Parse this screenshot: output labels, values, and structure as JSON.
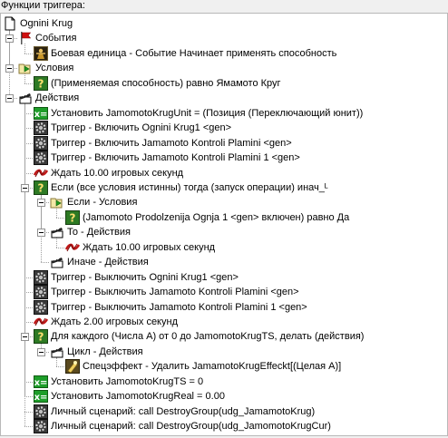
{
  "header": {
    "title": "Функции триггера:"
  },
  "tree": {
    "items": [
      {
        "label": "Ognini Krug",
        "icon": "document-icon",
        "level": 0
      },
      {
        "label": "События",
        "icon": "flag-icon",
        "level": 1,
        "expander": true
      },
      {
        "label": "Боевая единица - Событие Начинает применять способность",
        "icon": "unit-event-icon",
        "level": 2
      },
      {
        "label": "Условия",
        "icon": "condition-folder-icon",
        "level": 1,
        "expander": true
      },
      {
        "label": "(Применяемая способность) равно Ямамото Круг",
        "icon": "condition-icon",
        "level": 2
      },
      {
        "label": "Действия",
        "icon": "clapper-icon",
        "level": 1,
        "expander": true
      },
      {
        "label": "Установить JamomotoKrugUnit = (Позиция (Переключающий юнит))",
        "icon": "set-variable-icon",
        "level": 2
      },
      {
        "label": "Триггер - Включить Ognini Krug1 <gen>",
        "icon": "gear-icon",
        "level": 2
      },
      {
        "label": "Триггер - Включить Jamamoto Kontroli Plamini <gen>",
        "icon": "gear-icon",
        "level": 2
      },
      {
        "label": "Триггер - Включить Jamamoto Kontroli Plamini 1 <gen>",
        "icon": "gear-icon",
        "level": 2
      },
      {
        "label": "Ждать 10.00 игровых секунд",
        "icon": "wait-icon",
        "level": 2
      },
      {
        "label": "Если (все условия истинны) тогда (запуск операции) инач_ᴸ",
        "icon": "condition-icon",
        "level": 2,
        "expander": true
      },
      {
        "label": "Если - Условия",
        "icon": "condition-folder-icon",
        "level": 3,
        "expander": true
      },
      {
        "label": "(Jamomoto Prodolzenija Ognja 1 <gen> включен) равно Да",
        "icon": "condition-icon",
        "level": 4
      },
      {
        "label": "То - Действия",
        "icon": "clapper-icon",
        "level": 3,
        "expander": true
      },
      {
        "label": "Ждать 10.00 игровых секунд",
        "icon": "wait-icon",
        "level": 4
      },
      {
        "label": "Иначе - Действия",
        "icon": "clapper-icon",
        "level": 3
      },
      {
        "label": "Триггер - Выключить Ognini Krug1 <gen>",
        "icon": "gear-icon",
        "level": 2
      },
      {
        "label": "Триггер - Выключить Jamamoto Kontroli Plamini <gen>",
        "icon": "gear-icon",
        "level": 2
      },
      {
        "label": "Триггер - Выключить Jamamoto Kontroli Plamini 1 <gen>",
        "icon": "gear-icon",
        "level": 2
      },
      {
        "label": "Ждать 2.00 игровых секунд",
        "icon": "wait-icon",
        "level": 2
      },
      {
        "label": "Для каждого (Числа A) от 0 до JamomotoKrugTS, делать (действия)",
        "icon": "condition-icon",
        "level": 2,
        "expander": true
      },
      {
        "label": "Цикл - Действия",
        "icon": "clapper-icon",
        "level": 3,
        "expander": true
      },
      {
        "label": "Спецэффект - Удалить JamamotoKrugEffeckt[(Целая A)]",
        "icon": "special-effect-icon",
        "level": 4
      },
      {
        "label": "Установить JamomotoKrugTS = 0",
        "icon": "set-variable-icon",
        "level": 2
      },
      {
        "label": "Установить JamomotoKrugReal = 0.00",
        "icon": "set-variable-icon",
        "level": 2
      },
      {
        "label": "Личный сценарий:   call DestroyGroup(udg_JamamotoKrug)",
        "icon": "gear-icon",
        "level": 2
      },
      {
        "label": "Личный сценарий:   call DestroyGroup(udg_JamomotoKrugCur)",
        "icon": "gear-icon",
        "level": 2
      }
    ]
  },
  "colors": {
    "tree_background": "#ffffff",
    "window_background": "#f0f0f0",
    "set_variable_green": "#1e9e2a",
    "wait_red": "#c01818",
    "condition_green": "#2a8a20",
    "flag_red": "#d01010"
  }
}
